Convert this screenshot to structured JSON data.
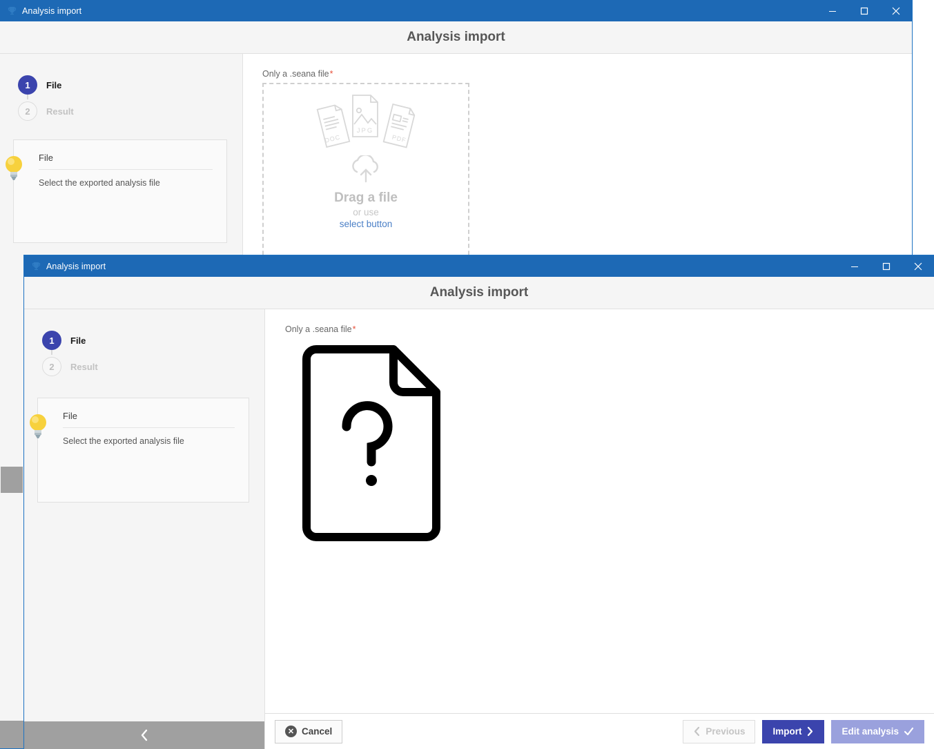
{
  "background_window": {
    "titlebar": {
      "icon": "trophy-icon",
      "title": "Analysis import",
      "minimize": "─",
      "maximize": "☐",
      "close": "✕"
    },
    "header_title": "Analysis import",
    "sidebar": {
      "steps": [
        {
          "number": "1",
          "label": "File",
          "state": "active"
        },
        {
          "number": "2",
          "label": "Result",
          "state": "inactive"
        }
      ],
      "hint": {
        "icon": "lightbulb-icon",
        "title": "File",
        "text": "Select the exported analysis file"
      },
      "collapse_icon": "chevron-left-icon"
    },
    "main": {
      "field_label": "Only a .seana file",
      "required_marker": "*",
      "dropzone": {
        "file_icons": [
          "doc-file-icon",
          "jpg-file-icon",
          "pdf-file-icon"
        ],
        "doc_label": "DOC",
        "jpg_label": "JPG",
        "pdf_label": "PDF",
        "upload_icon": "cloud-upload-icon",
        "drag_text": "Drag a file",
        "or_text": "or use",
        "select_link": "select button"
      }
    }
  },
  "foreground_window": {
    "titlebar": {
      "icon": "trophy-icon",
      "title": "Analysis import",
      "minimize": "─",
      "maximize": "☐",
      "close": "✕"
    },
    "header_title": "Analysis import",
    "sidebar": {
      "steps": [
        {
          "number": "1",
          "label": "File",
          "state": "active"
        },
        {
          "number": "2",
          "label": "Result",
          "state": "inactive"
        }
      ],
      "hint": {
        "icon": "lightbulb-icon",
        "title": "File",
        "text": "Select the exported analysis file"
      },
      "collapse_icon": "chevron-left-icon"
    },
    "main": {
      "field_label": "Only a .seana file",
      "required_marker": "*",
      "file_placeholder_icon": "unknown-file-question-icon"
    },
    "footer": {
      "cancel_label": "Cancel",
      "cancel_icon": "circle-x-icon",
      "previous_label": "Previous",
      "previous_icon": "chevron-left-icon",
      "import_label": "Import",
      "import_icon": "chevron-right-icon",
      "edit_analysis_label": "Edit analysis",
      "edit_analysis_icon": "check-icon"
    }
  },
  "colors": {
    "titlebar_blue": "#1d69b5",
    "window_border_blue": "#1d72c2",
    "accent_indigo": "#3b44ad",
    "accent_indigo_muted": "#9aa1dd",
    "required_red": "#e8503a",
    "link_blue": "#4a7fc6",
    "collapse_gray": "#a0a0a0",
    "bulb_yellow": "#f5d343"
  }
}
